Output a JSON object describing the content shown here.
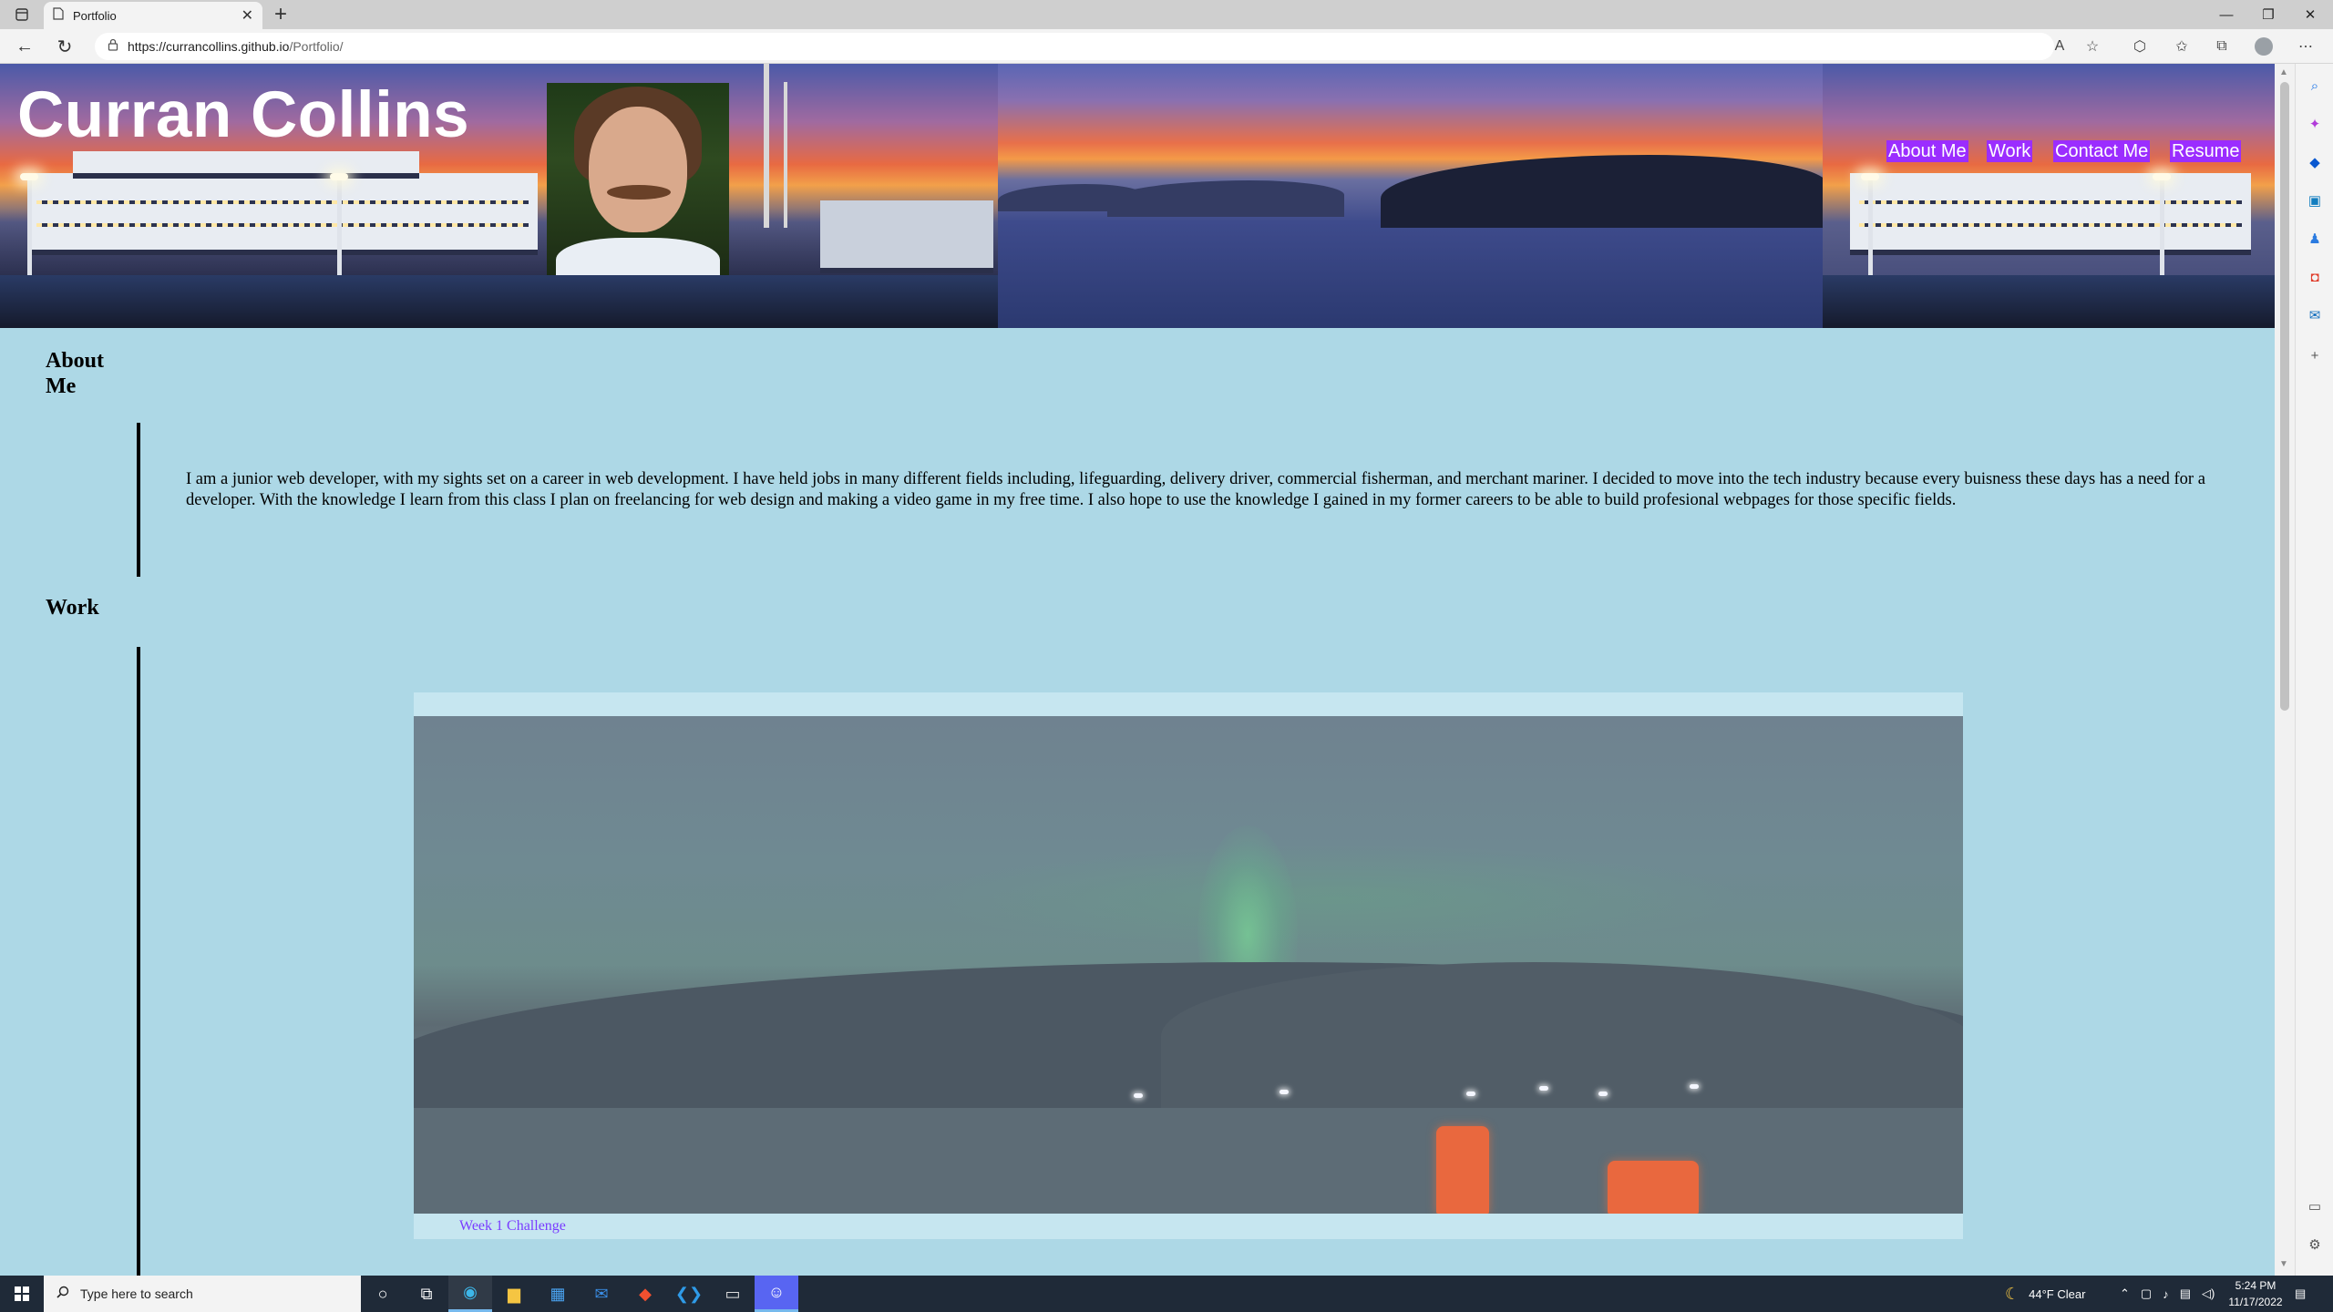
{
  "browser": {
    "tab_title": "Portfolio",
    "url_host": "https://currancollins.github.io",
    "url_path": "/Portfolio/"
  },
  "site": {
    "title": "Curran Collins",
    "nav": [
      "About Me",
      "Work",
      "Contact Me",
      "Resume"
    ],
    "about": {
      "heading": "About Me",
      "text": "I am a junior web developer, with my sights set on a career in web development. I have held jobs in many different fields including, lifeguarding, delivery driver, commercial fisherman, and merchant mariner. I decided to move into the tech industry because every buisness these days has a need for a developer. With the knowledge I learn from this class I plan on freelancing for web design and making a video game in my free time. I also hope to use the knowledge I gained in my former careers to be able to build profesional webpages for those specific fields."
    },
    "work": {
      "heading": "Work",
      "items": [
        {
          "caption": "Week 1 Challenge"
        }
      ]
    }
  },
  "taskbar": {
    "search_placeholder": "Type here to search",
    "weather": "44°F  Clear",
    "time": "5:24 PM",
    "date": "11/17/2022"
  },
  "colors": {
    "page_bg": "#add8e6",
    "nav_bg": "#9b2dff",
    "link": "#7a3cff"
  }
}
